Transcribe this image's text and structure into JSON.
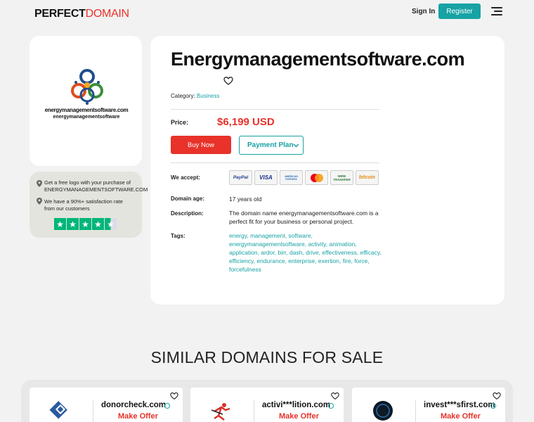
{
  "header": {
    "logo_part1": "PERFECT",
    "logo_part2": "DOMAIN",
    "signin_label": "Sign In",
    "register_label": "Register",
    "menu_icon": "hamburger-icon"
  },
  "logo_card": {
    "domain_text": "energymanagementsoftware.com",
    "name_text": "energymanagementsoftware"
  },
  "promo": {
    "line1": "Get a free logo with your purchase of ENERGYMANAGEMENTSOFTWARE.COM",
    "line2": "We have a 90%+ satisfaction rate from our customers",
    "rating_stars": 4.5,
    "star_color": "#00b67a"
  },
  "domain": {
    "title": "Energymanagementsoftware.com",
    "category_label": "Category:",
    "category_value": "Business",
    "price_label": "Price:",
    "price": "$6,199 USD",
    "buy_label": "Buy Now",
    "plan_label": "Payment Plan",
    "accept_label": "We accept:",
    "payment_methods": [
      "PayPal",
      "VISA",
      "AMERICAN EXPRESS",
      "mastercard",
      "WIRE TRANSFER",
      "bitcoin"
    ],
    "age_label": "Domain age:",
    "age_value": "17 years old",
    "description_label": "Description:",
    "description_value": "The domain name energymanagementsoftware.com is a perfect fit for your business or personal project.",
    "tags_label": "Tags:",
    "tags": "energy, management, software, energymanagementsoftware, activity, animation, application, ardor, birr, dash, drive, effectiveness, efficacy, efficiency, endurance, enterprise, exertion, fire, force, forcefulness"
  },
  "similar": {
    "title": "SIMILAR DOMAINS FOR SALE",
    "items": [
      {
        "name": "donorcheck.com",
        "offer": "Make Offer"
      },
      {
        "name": "activi***lition.com",
        "offer": "Make Offer"
      },
      {
        "name": "invest***sfirst.com",
        "offer": "Make Offer"
      }
    ]
  },
  "colors": {
    "accent": "#17a2a4",
    "price_red": "#e8322a",
    "background": "#f2f2f2"
  }
}
